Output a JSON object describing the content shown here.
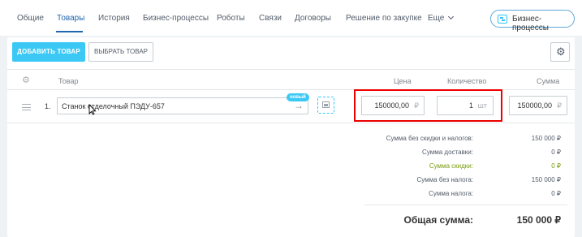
{
  "tabs": [
    {
      "label": "Общие"
    },
    {
      "label": "Товары"
    },
    {
      "label": "История"
    },
    {
      "label": "Бизнес-процессы"
    },
    {
      "label": "Роботы"
    },
    {
      "label": "Связи"
    },
    {
      "label": "Договоры"
    },
    {
      "label": "Решение по закупке"
    },
    {
      "label": "Еще"
    }
  ],
  "header": {
    "bp_button_label": "Бизнес-процессы"
  },
  "toolbar": {
    "add_label": "ДОБАВИТЬ ТОВАР",
    "choose_label": "ВЫБРАТЬ ТОВАР"
  },
  "table": {
    "headers": {
      "product": "Товар",
      "price": "Цена",
      "quantity": "Количество",
      "sum": "Сумма"
    },
    "row": {
      "num": "1.",
      "product_name": "Станок отделочный ПЭДУ-657",
      "badge": "новый",
      "price": "150000,00",
      "price_currency": "₽",
      "quantity": "1",
      "quantity_unit": "шт",
      "sum": "150000,00",
      "sum_currency": "₽"
    }
  },
  "summary": {
    "rows": [
      {
        "label": "Сумма без скидки и налогов:",
        "value": "150 000 ₽"
      },
      {
        "label": "Сумма доставки:",
        "value": "0 ₽"
      },
      {
        "label": "Сумма скидки:",
        "value": "0 ₽"
      },
      {
        "label": "Сумма без налога:",
        "value": "150 000 ₽"
      },
      {
        "label": "Сумма налога:",
        "value": "0 ₽"
      }
    ],
    "total_label": "Общая сумма:",
    "total_value": "150 000 ₽"
  },
  "colors": {
    "accent": "#3bc8f5",
    "active_tab": "#2067b0",
    "highlight": "#ed0000",
    "discount": "#7a9c0e"
  }
}
